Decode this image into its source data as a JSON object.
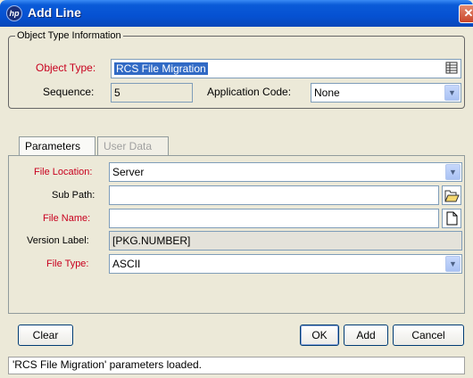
{
  "window": {
    "title": "Add Line",
    "icon": "hp-logo-icon",
    "close_glyph": "✕"
  },
  "object_type_group": {
    "legend": "Object Type Information",
    "object_type_label": "Object Type:",
    "object_type_value": "RCS File Migration",
    "sequence_label": "Sequence:",
    "sequence_value": "5",
    "app_code_label": "Application Code:",
    "app_code_value": "None"
  },
  "tabs": [
    {
      "label": "Parameters",
      "active": true
    },
    {
      "label": "User Data",
      "active": false
    }
  ],
  "parameters": {
    "file_location_label": "File Location:",
    "file_location_value": "Server",
    "sub_path_label": "Sub Path:",
    "sub_path_value": "",
    "file_name_label": "File Name:",
    "file_name_value": "",
    "version_label_label": "Version Label:",
    "version_label_value": "[PKG.NUMBER]",
    "file_type_label": "File Type:",
    "file_type_value": "ASCII"
  },
  "buttons": {
    "clear": "Clear",
    "ok": "OK",
    "add": "Add",
    "cancel": "Cancel"
  },
  "status": {
    "message": "'RCS File Migration' parameters loaded."
  },
  "colors": {
    "required_label": "#c8001e",
    "title_bar": "#0551d2",
    "selection": "#316ac5"
  }
}
